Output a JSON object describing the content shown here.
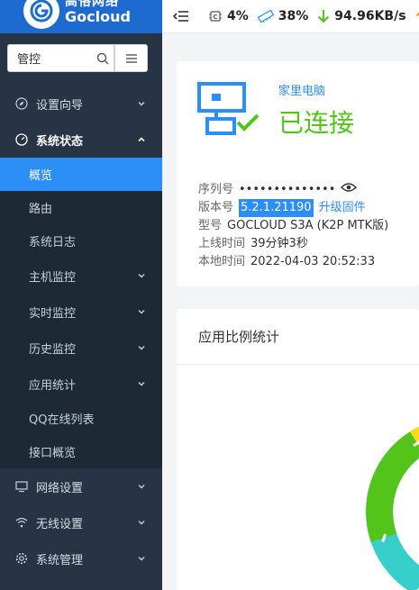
{
  "brand": {
    "name_cn": "高恪网络",
    "name_en": "Gocloud"
  },
  "sidebar": {
    "search": {
      "value": "管控"
    },
    "items": [
      {
        "label": "设置向导",
        "icon": "compass-icon"
      },
      {
        "label": "系统状态",
        "icon": "dashboard-icon",
        "open": true,
        "children": [
          {
            "label": "概览",
            "active": true
          },
          {
            "label": "路由"
          },
          {
            "label": "系统日志"
          },
          {
            "label": "主机监控",
            "has_children": true
          },
          {
            "label": "实时监控",
            "has_children": true
          },
          {
            "label": "历史监控",
            "has_children": true
          },
          {
            "label": "应用统计",
            "has_children": true
          },
          {
            "label": "QQ在线列表"
          },
          {
            "label": "接口概览"
          }
        ]
      },
      {
        "label": "网络设置",
        "icon": "monitor-icon"
      },
      {
        "label": "无线设置",
        "icon": "wifi-icon"
      },
      {
        "label": "系统管理",
        "icon": "gear-icon"
      }
    ]
  },
  "topbar": {
    "cpu": "4%",
    "memory": "38%",
    "download": "94.96KB/s"
  },
  "device": {
    "name": "家里电脑",
    "status": "已连接",
    "serial_label": "序列号",
    "serial_value": "••••••••••••••",
    "version_label": "版本号",
    "version_value": "5.2.1.21190",
    "upgrade_link": "升级固件",
    "model_label": "型号",
    "model_value": "GOCLOUD S3A (K2P MTK版)",
    "uptime_label": "上线时间",
    "uptime_value": "39分钟3秒",
    "localtime_label": "本地时间",
    "localtime_value": "2022-04-03 20:52:33"
  },
  "app_stats": {
    "title": "应用比例统计"
  },
  "colors": {
    "accent": "#2c8ff7",
    "success": "#52c41a",
    "sidebar": "#263445",
    "donut_yellow": "#fadb14",
    "donut_green": "#52c41a",
    "donut_teal": "#36cfc9"
  }
}
